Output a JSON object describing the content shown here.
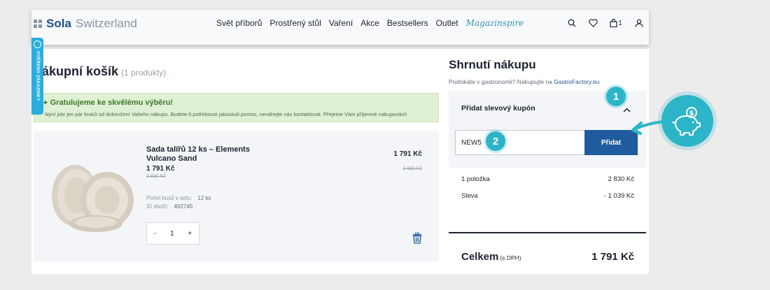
{
  "header": {
    "logo_brand": "Sola",
    "logo_rest": "Switzerland",
    "nav": [
      "Svět příborů",
      "Prostřený stůl",
      "Vaření",
      "Akce",
      "Bestsellers",
      "Outlet"
    ],
    "magazine": "Magazinspire",
    "cart_count": "1",
    "icons": [
      "search-icon",
      "heart-icon",
      "cart-icon",
      "user-icon"
    ]
  },
  "side_badge": {
    "text": "OVĚŘENO ZÁKAZNÍKY"
  },
  "cart": {
    "title": "ákupní košík",
    "count": "(1 produkty)",
    "congrats_title": "Gratulujeme ke skvělému výběru!",
    "congrats_text": "Nyní jste jen pár kroků od dokončení Vašeho nákupu. Budete-li potřebovat jakoukoli pomoc, neváhejte nás kontaktovat. Přejeme Vám příjemné nakupování!",
    "item": {
      "name": "Sada talířů 12 ks – Elements Vulcano Sand",
      "price": "1 791 Kč",
      "old_price": "2 830 Kč",
      "meta_set_label": "Počet kusů v setu:",
      "meta_set_value": "12 ks",
      "meta_id_label": "ID zboží:",
      "meta_id_value": "492745",
      "qty": "1",
      "minus": "-",
      "plus": "+",
      "right_price": "1 791 Kč",
      "right_old_price": "2 830 Kč"
    }
  },
  "summary": {
    "title": "Shrnutí nákupu",
    "sub": "Podnikáte v gastronomii? Nakupujte na",
    "sub_link": "GastroFactory.eu",
    "coupon_head": "Přidat slevový kupón",
    "coupon_value": "NEW5",
    "coupon_button": "Přidat",
    "rows": [
      {
        "label": "1 položka",
        "value": "2 830 Kč"
      },
      {
        "label": "Sleva",
        "value": "- 1 039 Kč"
      }
    ],
    "total_label": "Celkem",
    "total_note": "(s DPH)",
    "total_value": "1 791 Kč"
  },
  "annotations": {
    "step1": "1",
    "step2": "2"
  },
  "colors": {
    "accent": "#1f5b9e",
    "teal": "#2cb4c8",
    "success_bg": "#dff0d4"
  }
}
